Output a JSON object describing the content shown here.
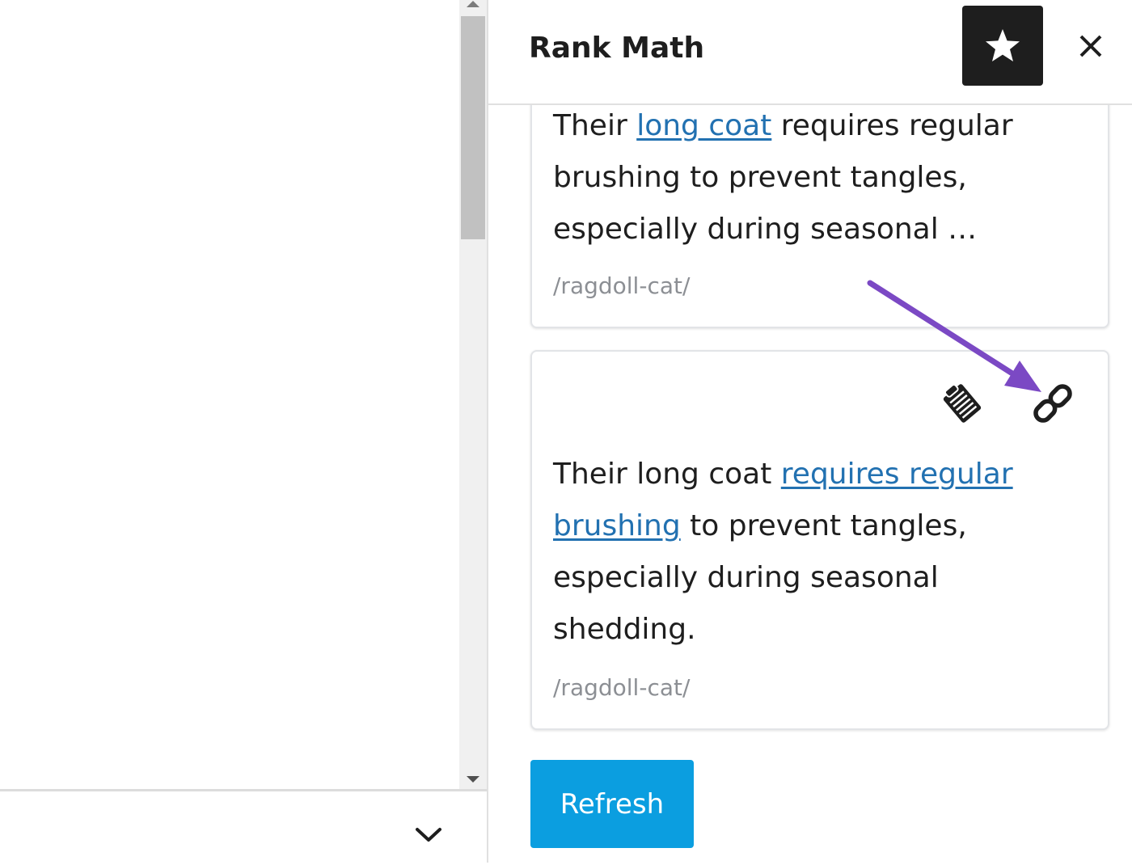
{
  "sidebar": {
    "title": "Rank Math",
    "star_icon": "star-icon",
    "close_icon": "close-icon"
  },
  "results": [
    {
      "text_before": "Their ",
      "link_text": "long coat",
      "text_after": " requires regular brushing to prevent tangles, especially during seasonal …",
      "url": "/ragdoll-cat/"
    },
    {
      "text_before": "Their long coat ",
      "link_text": "requires regular brushing",
      "text_after": " to prevent tangles, especially during seasonal shedding.",
      "url": "/ragdoll-cat/",
      "actions": [
        "clipboard-icon",
        "link-icon"
      ]
    }
  ],
  "refresh_label": "Refresh",
  "editor": {
    "collapse_icon": "chevron-down-icon"
  },
  "colors": {
    "link": "#2271b1",
    "refresh_button": "#0b9ee0",
    "annotation_arrow": "#7b49c4",
    "header_button": "#1e1e1e"
  }
}
